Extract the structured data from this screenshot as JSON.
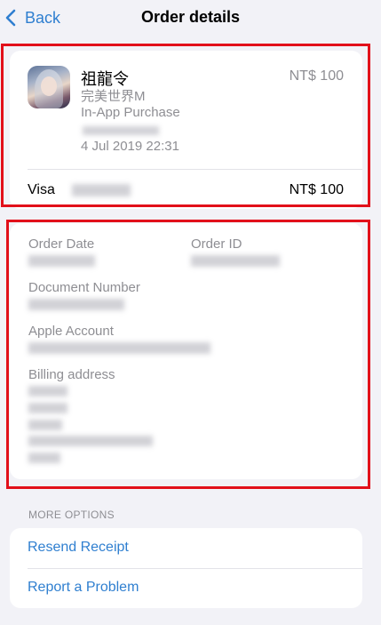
{
  "nav": {
    "back_label": "Back",
    "title": "Order details"
  },
  "purchase": {
    "app_name": "祖龍令",
    "game_title": "完美世界M",
    "type": "In-App Purchase",
    "date": "4 Jul 2019 22:31",
    "price": "NT$ 100",
    "payment_method": "Visa",
    "total": "NT$ 100"
  },
  "details": {
    "order_date_label": "Order Date",
    "order_id_label": "Order ID",
    "document_number_label": "Document Number",
    "apple_account_label": "Apple Account",
    "billing_address_label": "Billing address"
  },
  "more_options": {
    "header": "MORE OPTIONS",
    "resend_receipt": "Resend Receipt",
    "report_problem": "Report a Problem"
  },
  "colors": {
    "accent": "#2f7fd0",
    "highlight": "#e2101a",
    "background": "#f2f2f7"
  }
}
